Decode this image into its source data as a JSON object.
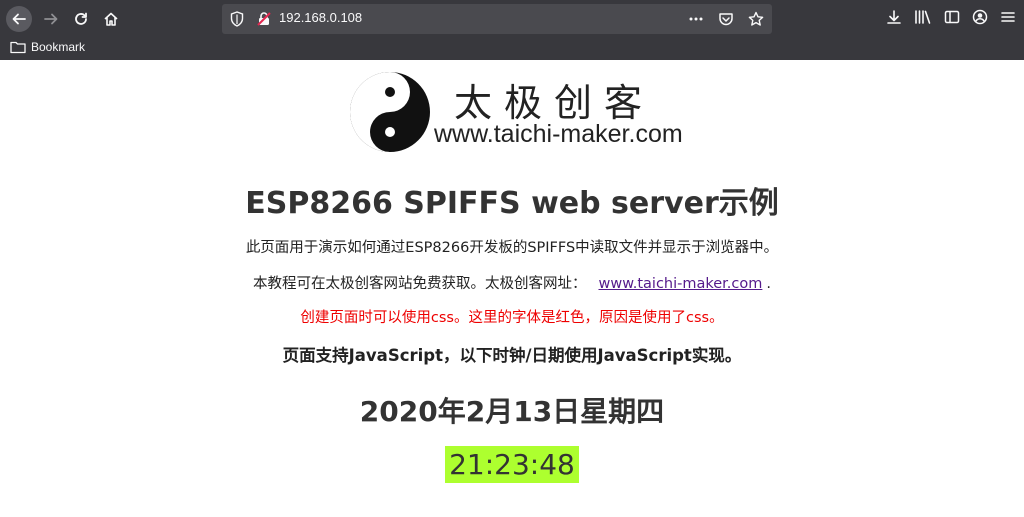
{
  "browser": {
    "url": "192.168.0.108",
    "bookmarks": [
      {
        "label": "Bookmark"
      }
    ],
    "icons": [
      "back-icon",
      "forward-icon",
      "reload-icon",
      "home-icon",
      "shield-icon",
      "insecure-lock-icon",
      "more-icon",
      "pocket-icon",
      "star-icon",
      "download-icon",
      "library-icon",
      "sidebar-icon",
      "account-icon",
      "menu-icon",
      "folder-icon"
    ]
  },
  "page": {
    "logo_cn": "太极创客",
    "logo_url": "www.taichi-maker.com",
    "title": "ESP8266 SPIFFS web server示例",
    "description": "此页面用于演示如何通过ESP8266开发板的SPIFFS中读取文件并显示于浏览器中。",
    "source_text": "本教程可在太极创客网站免费获取。太极创客网址：",
    "source_link": "www.taichi-maker.com",
    "source_suffix": ".",
    "css_note": "创建页面时可以使用css。这里的字体是红色，原因是使用了css。",
    "js_note": "页面支持JavaScript，以下时钟/日期使用JavaScript实现。",
    "date": "2020年2月13日星期四",
    "time": "21:23:48"
  },
  "colors": {
    "chrome_bg": "#38383d",
    "urlbar_bg": "#4a4a4f",
    "note_red": "#ee0000",
    "clock_highlight": "#adff2f",
    "link": "#551a8b"
  }
}
